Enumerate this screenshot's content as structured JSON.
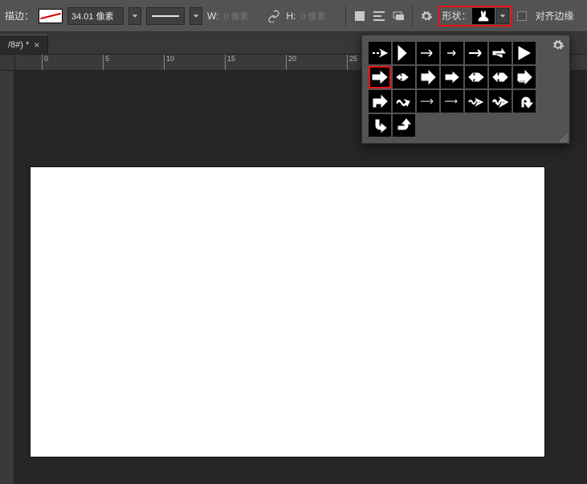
{
  "options": {
    "stroke_label": "描边：",
    "stroke_value": "34.01 像素",
    "w_label": "W:",
    "w_value": "0 像素",
    "h_label": "H:",
    "h_value": "0 像素",
    "shape_label": "形状：",
    "align_edges_label": "对齐边缘"
  },
  "tab": {
    "title": "/8#) *"
  },
  "ruler": {
    "marks": [
      "0",
      "5",
      "10",
      "15",
      "20",
      "25"
    ]
  },
  "shape_picker": {
    "highlight_shape_selector": true,
    "selected_index": 7,
    "shapes": [
      "arrow-dashtail",
      "chevron-bold",
      "arrow-thin",
      "arrow-thin-short",
      "arrow-long",
      "arrow-long2",
      "triangle-right",
      "arrow-bold",
      "arrow-feather",
      "arrow-block",
      "arrow-block2",
      "arrow-double",
      "arrow-double2",
      "arrow-3d",
      "arrow-curve-down",
      "arrow-wave",
      "arrow-thin2",
      "arrow-thin3",
      "arrow-squiggle",
      "arrow-squiggle2",
      "arrow-uturn",
      "arrow-hook-right",
      "arrow-hook-up"
    ]
  }
}
